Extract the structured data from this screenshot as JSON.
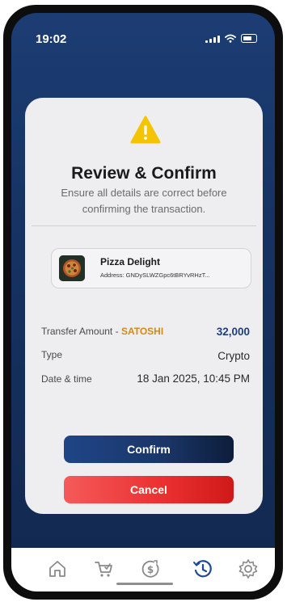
{
  "status_bar": {
    "time": "19:02"
  },
  "modal": {
    "title": "Review & Confirm",
    "subtitle": "Ensure all details are correct before confirming the transaction.",
    "merchant": {
      "name": "Pizza Delight",
      "address": "Address: GNDySLWZGpc6tBRYvRHzT..."
    },
    "details": {
      "amount_label": "Transfer Amount - ",
      "token": "SATOSHI",
      "amount_value": "32,000",
      "type_label": "Type",
      "type_value": "Crypto",
      "date_label": "Date & time",
      "date_value": "18 Jan 2025, 10:45 PM"
    },
    "confirm_label": "Confirm",
    "cancel_label": "Cancel"
  },
  "bottom_nav": {
    "items": [
      {
        "icon": "home-icon"
      },
      {
        "icon": "cart-icon"
      },
      {
        "icon": "dollar-coin-icon"
      },
      {
        "icon": "history-icon",
        "active": true
      },
      {
        "icon": "gear-icon"
      }
    ],
    "active_color": "#1d4a94",
    "inactive_color": "#8a8a8a"
  },
  "colors": {
    "background": "#163363",
    "accent": "#1d3f7f",
    "token": "#d48a12",
    "warning": "#f5c400",
    "cancel": "#ea2f2f"
  }
}
